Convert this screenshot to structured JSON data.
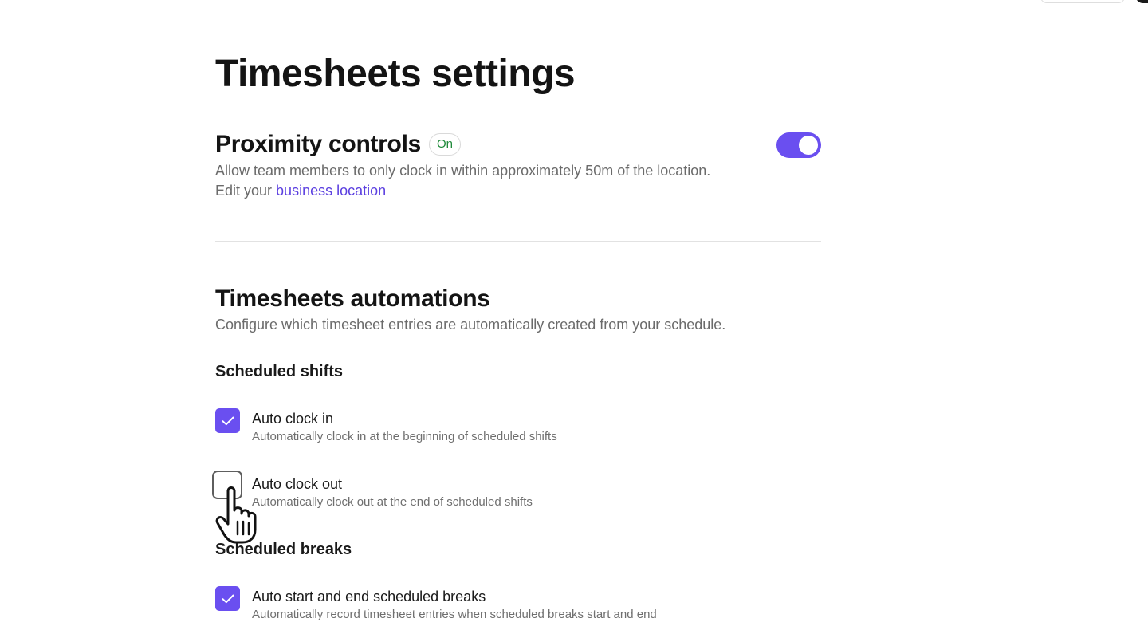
{
  "page": {
    "title": "Timesheets settings"
  },
  "proximity": {
    "title": "Proximity controls",
    "badge": "On",
    "toggle_state": "on",
    "description": "Allow team members to only clock in within approximately 50m of the location.",
    "edit_prefix": "Edit your ",
    "edit_link": "business location"
  },
  "automations": {
    "title": "Timesheets automations",
    "description": "Configure which timesheet entries are automatically created from your schedule.",
    "scheduled_shifts": {
      "heading": "Scheduled shifts",
      "options": [
        {
          "label": "Auto clock in",
          "description": "Automatically clock in at the beginning of scheduled shifts",
          "checked": true
        },
        {
          "label": "Auto clock out",
          "description": "Automatically clock out at the end of scheduled shifts",
          "checked": false
        }
      ]
    },
    "scheduled_breaks": {
      "heading": "Scheduled breaks",
      "options": [
        {
          "label": "Auto start and end scheduled breaks",
          "description": "Automatically record timesheet entries when scheduled breaks start and end",
          "checked": true
        }
      ]
    }
  },
  "colors": {
    "accent": "#6a4ff0",
    "link": "#5b3fe0",
    "badge_text": "#1f8a3a"
  },
  "icons": {
    "check": "check-icon",
    "cursor": "hand-pointer-cursor-icon"
  }
}
